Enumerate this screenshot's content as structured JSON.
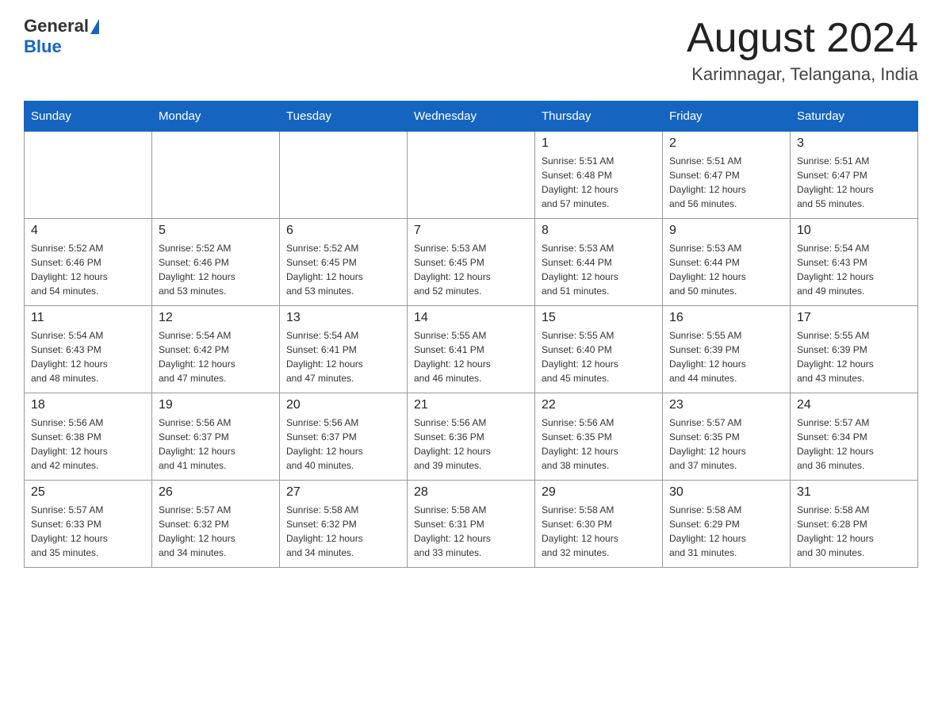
{
  "header": {
    "logo_general": "General",
    "logo_blue": "Blue",
    "month_title": "August 2024",
    "location": "Karimnagar, Telangana, India"
  },
  "days_of_week": [
    "Sunday",
    "Monday",
    "Tuesday",
    "Wednesday",
    "Thursday",
    "Friday",
    "Saturday"
  ],
  "weeks": [
    [
      {
        "day": "",
        "info": ""
      },
      {
        "day": "",
        "info": ""
      },
      {
        "day": "",
        "info": ""
      },
      {
        "day": "",
        "info": ""
      },
      {
        "day": "1",
        "info": "Sunrise: 5:51 AM\nSunset: 6:48 PM\nDaylight: 12 hours\nand 57 minutes."
      },
      {
        "day": "2",
        "info": "Sunrise: 5:51 AM\nSunset: 6:47 PM\nDaylight: 12 hours\nand 56 minutes."
      },
      {
        "day": "3",
        "info": "Sunrise: 5:51 AM\nSunset: 6:47 PM\nDaylight: 12 hours\nand 55 minutes."
      }
    ],
    [
      {
        "day": "4",
        "info": "Sunrise: 5:52 AM\nSunset: 6:46 PM\nDaylight: 12 hours\nand 54 minutes."
      },
      {
        "day": "5",
        "info": "Sunrise: 5:52 AM\nSunset: 6:46 PM\nDaylight: 12 hours\nand 53 minutes."
      },
      {
        "day": "6",
        "info": "Sunrise: 5:52 AM\nSunset: 6:45 PM\nDaylight: 12 hours\nand 53 minutes."
      },
      {
        "day": "7",
        "info": "Sunrise: 5:53 AM\nSunset: 6:45 PM\nDaylight: 12 hours\nand 52 minutes."
      },
      {
        "day": "8",
        "info": "Sunrise: 5:53 AM\nSunset: 6:44 PM\nDaylight: 12 hours\nand 51 minutes."
      },
      {
        "day": "9",
        "info": "Sunrise: 5:53 AM\nSunset: 6:44 PM\nDaylight: 12 hours\nand 50 minutes."
      },
      {
        "day": "10",
        "info": "Sunrise: 5:54 AM\nSunset: 6:43 PM\nDaylight: 12 hours\nand 49 minutes."
      }
    ],
    [
      {
        "day": "11",
        "info": "Sunrise: 5:54 AM\nSunset: 6:43 PM\nDaylight: 12 hours\nand 48 minutes."
      },
      {
        "day": "12",
        "info": "Sunrise: 5:54 AM\nSunset: 6:42 PM\nDaylight: 12 hours\nand 47 minutes."
      },
      {
        "day": "13",
        "info": "Sunrise: 5:54 AM\nSunset: 6:41 PM\nDaylight: 12 hours\nand 47 minutes."
      },
      {
        "day": "14",
        "info": "Sunrise: 5:55 AM\nSunset: 6:41 PM\nDaylight: 12 hours\nand 46 minutes."
      },
      {
        "day": "15",
        "info": "Sunrise: 5:55 AM\nSunset: 6:40 PM\nDaylight: 12 hours\nand 45 minutes."
      },
      {
        "day": "16",
        "info": "Sunrise: 5:55 AM\nSunset: 6:39 PM\nDaylight: 12 hours\nand 44 minutes."
      },
      {
        "day": "17",
        "info": "Sunrise: 5:55 AM\nSunset: 6:39 PM\nDaylight: 12 hours\nand 43 minutes."
      }
    ],
    [
      {
        "day": "18",
        "info": "Sunrise: 5:56 AM\nSunset: 6:38 PM\nDaylight: 12 hours\nand 42 minutes."
      },
      {
        "day": "19",
        "info": "Sunrise: 5:56 AM\nSunset: 6:37 PM\nDaylight: 12 hours\nand 41 minutes."
      },
      {
        "day": "20",
        "info": "Sunrise: 5:56 AM\nSunset: 6:37 PM\nDaylight: 12 hours\nand 40 minutes."
      },
      {
        "day": "21",
        "info": "Sunrise: 5:56 AM\nSunset: 6:36 PM\nDaylight: 12 hours\nand 39 minutes."
      },
      {
        "day": "22",
        "info": "Sunrise: 5:56 AM\nSunset: 6:35 PM\nDaylight: 12 hours\nand 38 minutes."
      },
      {
        "day": "23",
        "info": "Sunrise: 5:57 AM\nSunset: 6:35 PM\nDaylight: 12 hours\nand 37 minutes."
      },
      {
        "day": "24",
        "info": "Sunrise: 5:57 AM\nSunset: 6:34 PM\nDaylight: 12 hours\nand 36 minutes."
      }
    ],
    [
      {
        "day": "25",
        "info": "Sunrise: 5:57 AM\nSunset: 6:33 PM\nDaylight: 12 hours\nand 35 minutes."
      },
      {
        "day": "26",
        "info": "Sunrise: 5:57 AM\nSunset: 6:32 PM\nDaylight: 12 hours\nand 34 minutes."
      },
      {
        "day": "27",
        "info": "Sunrise: 5:58 AM\nSunset: 6:32 PM\nDaylight: 12 hours\nand 34 minutes."
      },
      {
        "day": "28",
        "info": "Sunrise: 5:58 AM\nSunset: 6:31 PM\nDaylight: 12 hours\nand 33 minutes."
      },
      {
        "day": "29",
        "info": "Sunrise: 5:58 AM\nSunset: 6:30 PM\nDaylight: 12 hours\nand 32 minutes."
      },
      {
        "day": "30",
        "info": "Sunrise: 5:58 AM\nSunset: 6:29 PM\nDaylight: 12 hours\nand 31 minutes."
      },
      {
        "day": "31",
        "info": "Sunrise: 5:58 AM\nSunset: 6:28 PM\nDaylight: 12 hours\nand 30 minutes."
      }
    ]
  ]
}
